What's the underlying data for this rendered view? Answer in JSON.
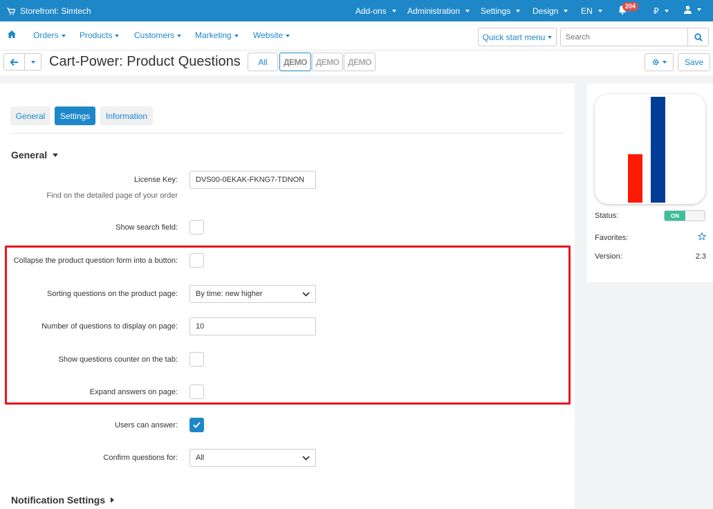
{
  "topbar": {
    "store": "Storefront: Simtech",
    "addons": "Add-ons",
    "administration": "Administration",
    "settings": "Settings",
    "design": "Design",
    "language": "EN",
    "notifications_count": "204",
    "currency": "₽"
  },
  "nav": {
    "orders": "Orders",
    "products": "Products",
    "customers": "Customers",
    "marketing": "Marketing",
    "website": "Website",
    "quick_start": "Quick start menu",
    "search_placeholder": "Search"
  },
  "title": {
    "text": "Cart-Power: Product Questions",
    "all_stores": "All",
    "demo_logo": "ДЕМО"
  },
  "toolbar": {
    "save": "Save"
  },
  "tabs": [
    "General",
    "Settings",
    "Information"
  ],
  "sections": {
    "general": "General",
    "notifications": "Notification Settings"
  },
  "fields": {
    "license_key": {
      "label": "License Key:",
      "value": "DVS00-0EKAK-FKNG7-TDNON",
      "help": "Find on the detailed page of your order"
    },
    "show_search": {
      "label": "Show search field:"
    },
    "collapse_form": {
      "label": "Collapse the product question form into a button:"
    },
    "sorting": {
      "label": "Sorting questions on the product page:",
      "value": "By time: new higher"
    },
    "num_questions": {
      "label": "Number of questions to display on page:",
      "value": "10"
    },
    "show_counter": {
      "label": "Show questions counter on the tab:"
    },
    "expand_answers": {
      "label": "Expand answers on page:"
    },
    "users_answer": {
      "label": "Users can answer:"
    },
    "confirm_for": {
      "label": "Confirm questions for:",
      "value": "All"
    }
  },
  "sidebar": {
    "status_label": "Status:",
    "status_value": "ON",
    "favorites_label": "Favorites:",
    "version_label": "Version:",
    "version_value": "2.3"
  },
  "colors": {
    "primary": "#1e87c8",
    "highlight": "#e8141c",
    "logo_red": "#ff1a05",
    "logo_blue": "#003d99",
    "toggle_on": "#3dbf9a"
  }
}
